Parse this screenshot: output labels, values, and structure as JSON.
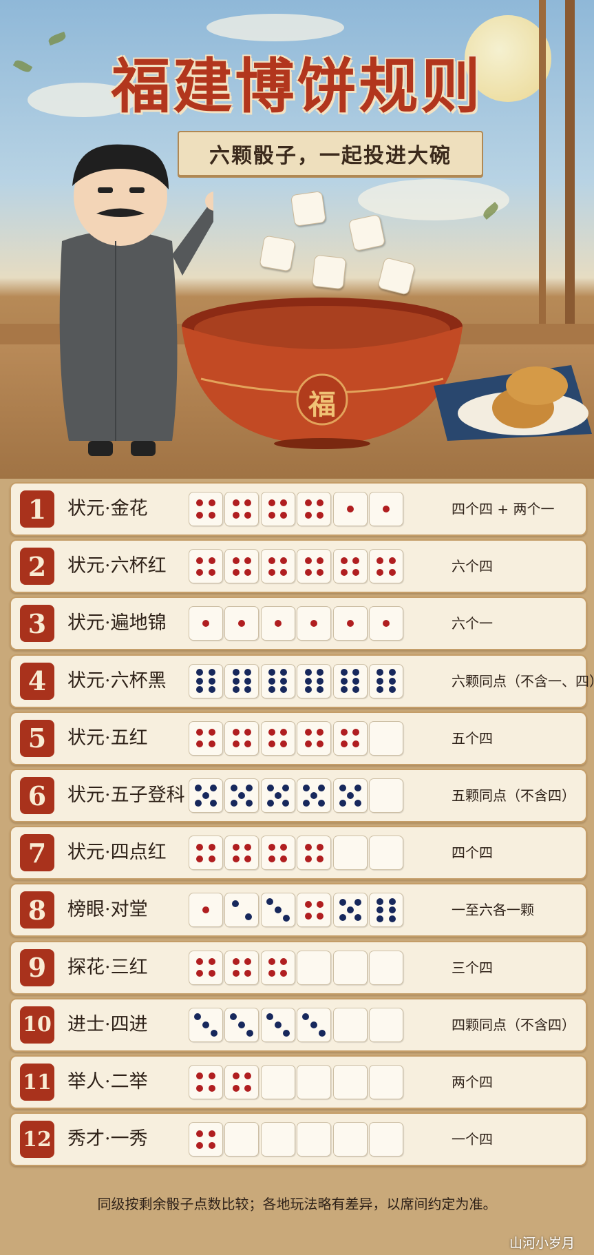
{
  "title": "福建博饼规则",
  "subtitle": "六颗骰子，一起投进大碗",
  "bowl_char": "福",
  "colors": {
    "red_pip": "#b01e20",
    "blue_pip": "#17285c",
    "badge": "#a9321c",
    "title": "#b2361d"
  },
  "rules": [
    {
      "num": "1",
      "name": "状元·金花",
      "dice": [
        4,
        4,
        4,
        4,
        1,
        1
      ],
      "color": [
        "r",
        "r",
        "r",
        "r",
        "r",
        "r"
      ],
      "note": "四个四 + 两个一"
    },
    {
      "num": "2",
      "name": "状元·六杯红",
      "dice": [
        4,
        4,
        4,
        4,
        4,
        4
      ],
      "color": [
        "r",
        "r",
        "r",
        "r",
        "r",
        "r"
      ],
      "note": "六个四"
    },
    {
      "num": "3",
      "name": "状元·遍地锦",
      "dice": [
        1,
        1,
        1,
        1,
        1,
        1
      ],
      "color": [
        "r",
        "r",
        "r",
        "r",
        "r",
        "r"
      ],
      "note": "六个一"
    },
    {
      "num": "4",
      "name": "状元·六杯黑",
      "dice": [
        6,
        6,
        6,
        6,
        6,
        6
      ],
      "color": [
        "b",
        "b",
        "b",
        "b",
        "b",
        "b"
      ],
      "note": "六颗同点（不含一、四）"
    },
    {
      "num": "5",
      "name": "状元·五红",
      "dice": [
        4,
        4,
        4,
        4,
        4,
        0
      ],
      "color": [
        "r",
        "r",
        "r",
        "r",
        "r",
        "r"
      ],
      "note": "五个四"
    },
    {
      "num": "6",
      "name": "状元·五子登科",
      "dice": [
        5,
        5,
        5,
        5,
        5,
        0
      ],
      "color": [
        "b",
        "b",
        "b",
        "b",
        "b",
        "b"
      ],
      "note": "五颗同点（不含四）"
    },
    {
      "num": "7",
      "name": "状元·四点红",
      "dice": [
        4,
        4,
        4,
        4,
        0,
        0
      ],
      "color": [
        "r",
        "r",
        "r",
        "r",
        "r",
        "r"
      ],
      "note": "四个四"
    },
    {
      "num": "8",
      "name": "榜眼·对堂",
      "dice": [
        1,
        2,
        3,
        4,
        5,
        6
      ],
      "color": [
        "r",
        "b",
        "b",
        "r",
        "b",
        "b"
      ],
      "note": "一至六各一颗"
    },
    {
      "num": "9",
      "name": "探花·三红",
      "dice": [
        4,
        4,
        4,
        0,
        0,
        0
      ],
      "color": [
        "r",
        "r",
        "r",
        "r",
        "r",
        "r"
      ],
      "note": "三个四"
    },
    {
      "num": "10",
      "name": "进士·四进",
      "dice": [
        3,
        3,
        3,
        3,
        0,
        0
      ],
      "color": [
        "b",
        "b",
        "b",
        "b",
        "b",
        "b"
      ],
      "note": "四颗同点（不含四）"
    },
    {
      "num": "11",
      "name": "举人·二举",
      "dice": [
        4,
        4,
        0,
        0,
        0,
        0
      ],
      "color": [
        "r",
        "r",
        "r",
        "r",
        "r",
        "r"
      ],
      "note": "两个四"
    },
    {
      "num": "12",
      "name": "秀才·一秀",
      "dice": [
        4,
        0,
        0,
        0,
        0,
        0
      ],
      "color": [
        "r",
        "r",
        "r",
        "r",
        "r",
        "r"
      ],
      "note": "一个四"
    }
  ],
  "footer": "同级按剩余骰子点数比较；各地玩法略有差异，以席间约定为准。",
  "brand": "山河小岁月"
}
